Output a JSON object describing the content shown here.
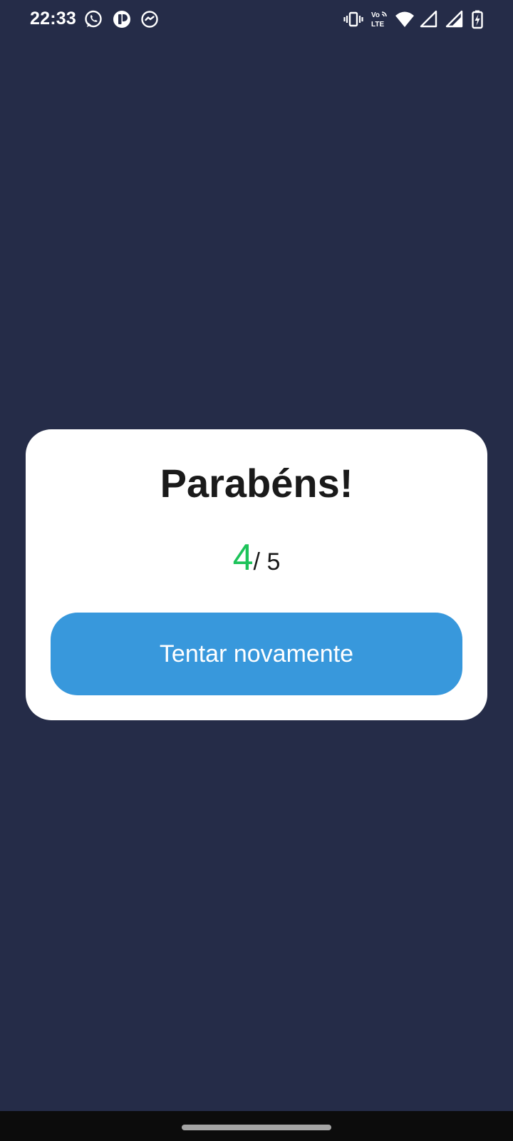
{
  "status_bar": {
    "time": "22:33",
    "network_label_top": "Vo",
    "network_label_bottom": "LTE",
    "icons": {
      "left": [
        "whatsapp-icon",
        "app-icon",
        "messenger-icon"
      ],
      "right": [
        "vibrate-icon",
        "volte-icon",
        "wifi-icon",
        "signal-icon",
        "signal-icon",
        "battery-charging-icon"
      ]
    }
  },
  "result": {
    "title": "Parabéns!",
    "score": "4",
    "separator": "/ ",
    "total": "5",
    "retry_label": "Tentar novamente"
  },
  "colors": {
    "background": "#252C48",
    "card": "#FFFFFF",
    "score": "#1DC35A",
    "button": "#3898DC",
    "nav_bar": "#0C0C0C"
  }
}
